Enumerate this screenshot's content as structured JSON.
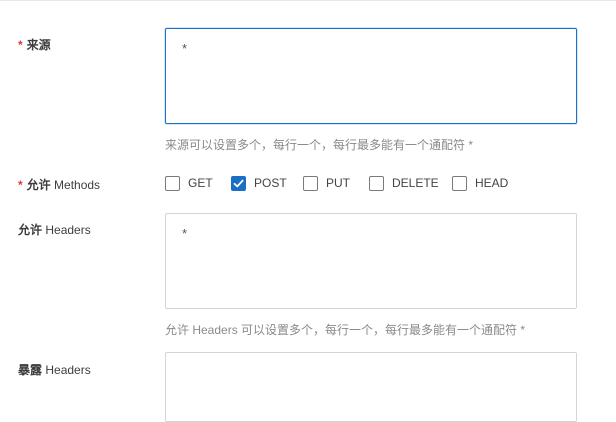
{
  "origins": {
    "required_mark": "*",
    "label": "来源",
    "value": "*",
    "help": "来源可以设置多个，每行一个，每行最多能有一个通配符 *"
  },
  "methods": {
    "required_mark": "*",
    "label_cn": "允许",
    "label_en": "Methods",
    "options": [
      {
        "label": "GET",
        "checked": false
      },
      {
        "label": "POST",
        "checked": true
      },
      {
        "label": "PUT",
        "checked": false
      },
      {
        "label": "DELETE",
        "checked": false
      },
      {
        "label": "HEAD",
        "checked": false
      }
    ],
    "checked_color": "#1a6fc4"
  },
  "allow_headers": {
    "label_cn": "允许",
    "label_en": "Headers",
    "value": "*",
    "help": "允许 Headers 可以设置多个，每行一个，每行最多能有一个通配符 *"
  },
  "expose_headers": {
    "label_cn": "暴露",
    "label_en": "Headers",
    "value": ""
  },
  "colors": {
    "focus_border": "#1a73c8",
    "required": "#e0393e"
  }
}
